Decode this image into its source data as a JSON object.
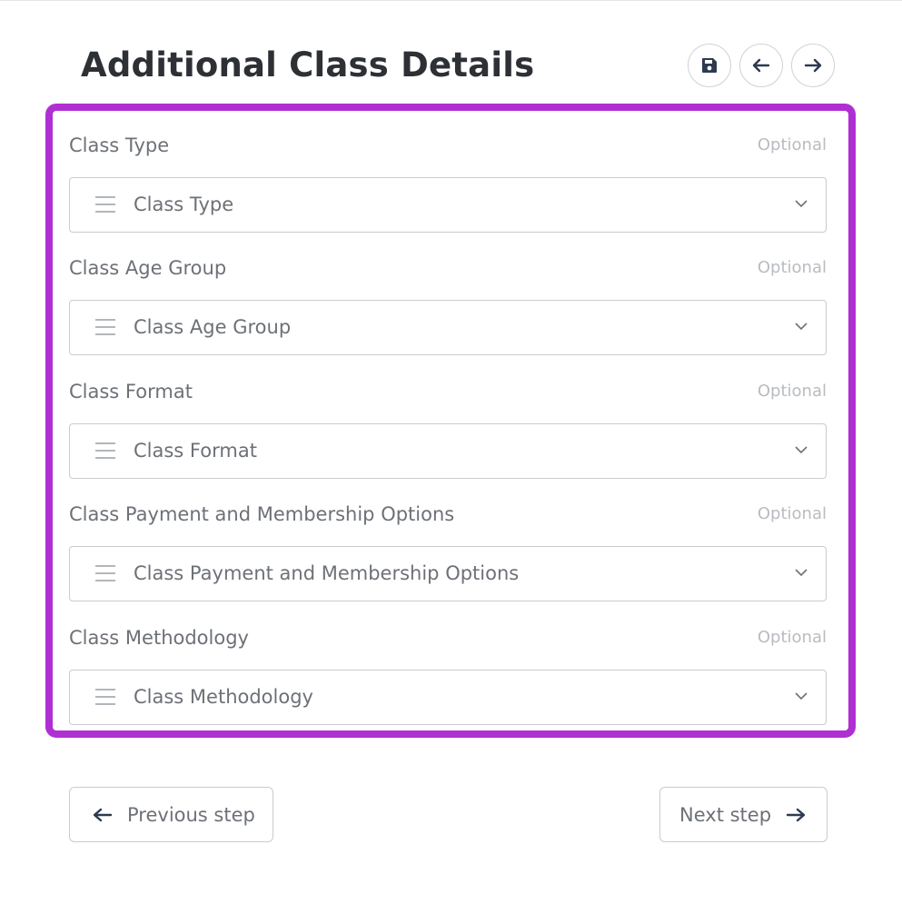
{
  "header": {
    "title": "Additional Class Details",
    "actions": [
      {
        "name": "save-button",
        "icon": "floppy-disk-icon"
      },
      {
        "name": "back-button",
        "icon": "arrow-left-icon"
      },
      {
        "name": "forward-button",
        "icon": "arrow-right-icon"
      }
    ]
  },
  "form": {
    "border_color": "#b02fd3",
    "fields": [
      {
        "label": "Class Type",
        "optional": "Optional",
        "placeholder": "Class Type",
        "icon": "list-icon"
      },
      {
        "label": "Class Age Group",
        "optional": "Optional",
        "placeholder": "Class Age Group",
        "icon": "list-icon"
      },
      {
        "label": "Class Format",
        "optional": "Optional",
        "placeholder": "Class Format",
        "icon": "list-icon"
      },
      {
        "label": "Class Payment and Membership Options",
        "optional": "Optional",
        "placeholder": "Class Payment and Membership Options",
        "icon": "list-icon"
      },
      {
        "label": "Class Methodology",
        "optional": "Optional",
        "placeholder": "Class Methodology",
        "icon": "list-icon"
      }
    ]
  },
  "footer": {
    "previous_label": "Previous step",
    "next_label": "Next step"
  }
}
